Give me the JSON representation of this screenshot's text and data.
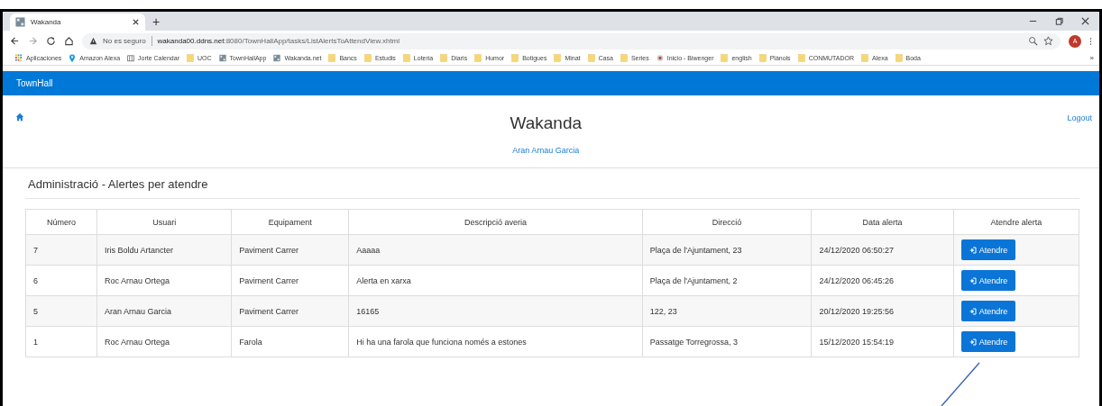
{
  "browser": {
    "tab_title": "Wakanda",
    "new_tab": "+",
    "security": "No es seguro",
    "url_host": "wakanda00.ddns.net",
    "url_path": ":8080/TownHallApp/tasks/ListAlertsToAttendView.xhtml",
    "avatar": "A",
    "more_bookmarks": "»"
  },
  "bookmarks": [
    {
      "label": "Aplicaciones",
      "kind": "apps"
    },
    {
      "label": "Amazon Alexa",
      "kind": "pin"
    },
    {
      "label": "Jorte Calendar",
      "kind": "calendar"
    },
    {
      "label": "UOC",
      "kind": "folder"
    },
    {
      "label": "TownHallApp",
      "kind": "site"
    },
    {
      "label": "Wakanda.net",
      "kind": "site"
    },
    {
      "label": "Bancs",
      "kind": "folder"
    },
    {
      "label": "Estudis",
      "kind": "folder"
    },
    {
      "label": "Loteria",
      "kind": "folder"
    },
    {
      "label": "Diaris",
      "kind": "folder"
    },
    {
      "label": "Humor",
      "kind": "folder"
    },
    {
      "label": "Botigues",
      "kind": "folder"
    },
    {
      "label": "Minat",
      "kind": "folder"
    },
    {
      "label": "Casa",
      "kind": "folder"
    },
    {
      "label": "Series",
      "kind": "folder"
    },
    {
      "label": "Inicio - Biwenger",
      "kind": "ball"
    },
    {
      "label": "english",
      "kind": "folder"
    },
    {
      "label": "Plànols",
      "kind": "folder"
    },
    {
      "label": "CONMUTADOR",
      "kind": "folder"
    },
    {
      "label": "Alexa",
      "kind": "folder"
    },
    {
      "label": "Boda",
      "kind": "folder"
    }
  ],
  "navbar": {
    "brand": "TownHall"
  },
  "header": {
    "title": "Wakanda",
    "user": "Aran Arnau Garcia",
    "logout": "Logout"
  },
  "section_title": "Administració - Alertes per atendre",
  "table": {
    "columns": [
      "Número",
      "Usuari",
      "Equipament",
      "Descripció averia",
      "Direcció",
      "Data alerta",
      "Atendre alerta"
    ],
    "rows": [
      {
        "cells": [
          "7",
          "Iris Boldu Artancter",
          "Paviment Carrer",
          "Aaaaa",
          "Plaça de l'Ajuntament, 23",
          "24/12/2020 06:50:27"
        ],
        "action": "Atendre"
      },
      {
        "cells": [
          "6",
          "Roc Arnau Ortega",
          "Paviment Carrer",
          "Alerta en xarxa",
          "Plaça de l'Ajuntament, 2",
          "24/12/2020 06:45:26"
        ],
        "action": "Atendre"
      },
      {
        "cells": [
          "5",
          "Aran Arnau Garcia",
          "Paviment Carrer",
          "16165",
          "122, 23",
          "20/12/2020 19:25:56"
        ],
        "action": "Atendre"
      },
      {
        "cells": [
          "1",
          "Roc Arnau Ortega",
          "Farola",
          "Hi ha una farola que funciona només a estones",
          "Passatge Torregrossa, 3",
          "15/12/2020 15:54:19"
        ],
        "action": "Atendre"
      }
    ]
  }
}
